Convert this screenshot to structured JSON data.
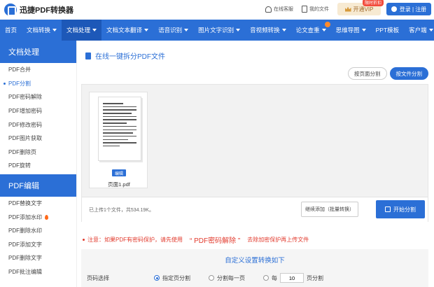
{
  "header": {
    "logo_text": "迅捷PDF转换器",
    "links": [
      "在线客服",
      "我的文件"
    ],
    "vip_label": "开通VIP",
    "vip_badge": "限时折扣",
    "login_label": "登录 | 注册"
  },
  "nav": [
    {
      "label": "首页",
      "caret": false
    },
    {
      "label": "文档转换",
      "caret": true
    },
    {
      "label": "文档处理",
      "caret": true,
      "active": true
    },
    {
      "label": "文档文本翻译",
      "caret": true
    },
    {
      "label": "语音识别",
      "caret": true
    },
    {
      "label": "图片文字识别",
      "caret": true
    },
    {
      "label": "音视频转换",
      "caret": true
    },
    {
      "label": "论文查重",
      "caret": true,
      "hot": true
    },
    {
      "label": "思维导图",
      "caret": true
    },
    {
      "label": "PPT模板",
      "caret": false
    },
    {
      "label": "客户端",
      "caret": true
    }
  ],
  "sidebar": {
    "section1_title": "文档处理",
    "section1_items": [
      "PDF合并",
      "PDF分割",
      "PDF密码解除",
      "PDF增加密码",
      "PDF修改密码",
      "PDF图片获取",
      "PDF删除页",
      "PDF旋转"
    ],
    "active_item": "PDF分割",
    "section2_title": "PDF编辑",
    "section2_items": [
      "PDF替换文字",
      "PDF添加水印",
      "PDF删除水印",
      "PDF添加文字",
      "PDF删除文字",
      "PDF批注编辑"
    ]
  },
  "main": {
    "title": "在线一键拆分PDF文件",
    "modes": [
      {
        "label": "按页面分割",
        "on": false
      },
      {
        "label": "按文件分割",
        "on": true
      }
    ],
    "file": {
      "name": "页面1.pdf",
      "edit_label": "编辑"
    },
    "upload_info": "已上传1个文件，共534.19K。",
    "continue_label": "继续添加（批量转换）",
    "start_label": "开始分割",
    "notice_prefix": "注意：如果PDF有密码保护，请先使用",
    "notice_link": "“ PDF密码解除 ”",
    "notice_suffix": "去除加密保护再上传文件",
    "settings_title": "自定义设置转换如下",
    "option_label": "页码选择",
    "option_specified": "指定页分割",
    "option_each": "分割每一页",
    "option_every_prefix": "每",
    "option_every_value": "10",
    "option_every_suffix": "页分割"
  },
  "colors": {
    "primary": "#2b6fd6",
    "notice": "#e23b2e"
  }
}
